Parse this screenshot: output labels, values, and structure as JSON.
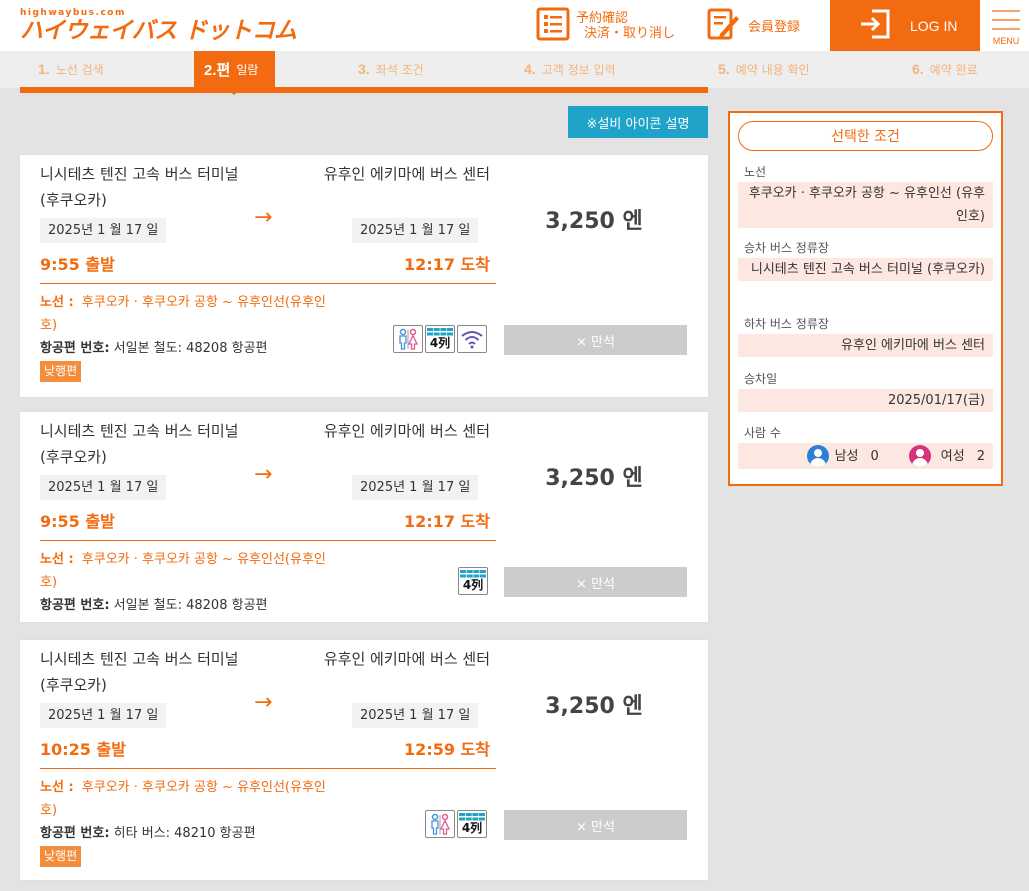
{
  "header": {
    "logo_sub": "highwaybus.com",
    "logo_main": "ハイウェイバス ドットコム",
    "reserve_line1": "予約確認",
    "reserve_line2": "決済・取り消し",
    "member_label": "会員登録",
    "login_label": "LOG IN",
    "menu_label": "MENU",
    "accent_color": "#f26b10"
  },
  "steps": [
    {
      "num": "1.",
      "label": "노선 검색"
    },
    {
      "num": "2.편",
      "label": "일람"
    },
    {
      "num": "3.",
      "label": "좌석 조건"
    },
    {
      "num": "4.",
      "label": "고객 정보 입력"
    },
    {
      "num": "5.",
      "label": "예약 내용 확인"
    },
    {
      "num": "6.",
      "label": "예약 완료"
    }
  ],
  "equipment_button": "※설비 아이콘 설명",
  "results": [
    {
      "dep_name": "니시테츠 텐진 고속 버스 터미널 (후쿠오카)",
      "arr_name": "유후인 에키마에 버스 센터",
      "dep_date": "2025년 1 월 17 일",
      "arr_date": "2025년 1 월 17 일",
      "dep_time": "9:55 출발",
      "arr_time": "12:17 도착",
      "price": "3,250 엔",
      "route_label": "노선 :",
      "route": "후쿠오카 · 후쿠오카 공항 ~ 유후인선(유후인호)",
      "flight_label": "항공편 번호:",
      "flight": "서일본 철도: 48208 항공편",
      "badge": "낮행편",
      "seat_icon_label": "4列",
      "icons": [
        "restroom-icon",
        "four-row-seat-icon",
        "wifi-icon"
      ],
      "status": "× 만석"
    },
    {
      "dep_name": "니시테츠 텐진 고속 버스 터미널 (후쿠오카)",
      "arr_name": "유후인 에키마에 버스 센터",
      "dep_date": "2025년 1 월 17 일",
      "arr_date": "2025년 1 월 17 일",
      "dep_time": "9:55 출발",
      "arr_time": "12:17 도착",
      "price": "3,250 엔",
      "route_label": "노선 :",
      "route": "후쿠오카 · 후쿠오카 공항 ~ 유후인선(유후인호)",
      "flight_label": "항공편 번호:",
      "flight": "서일본 철도: 48208 항공편",
      "seat_icon_label": "4列",
      "icons": [
        "four-row-seat-icon"
      ],
      "status": "× 만석"
    },
    {
      "dep_name": "니시테츠 텐진 고속 버스 터미널 (후쿠오카)",
      "arr_name": "유후인 에키마에 버스 센터",
      "dep_date": "2025년 1 월 17 일",
      "arr_date": "2025년 1 월 17 일",
      "dep_time": "10:25 출발",
      "arr_time": "12:59 도착",
      "price": "3,250 엔",
      "route_label": "노선 :",
      "route": "후쿠오카 · 후쿠오카 공항 ~ 유후인선(유후인호)",
      "flight_label": "항공편 번호:",
      "flight": "히타 버스: 48210 항공편",
      "badge": "낮행편",
      "seat_icon_label": "4列",
      "icons": [
        "restroom-icon",
        "four-row-seat-icon"
      ],
      "status": "× 만석"
    }
  ],
  "conditions": {
    "title": "선택한 조건",
    "route_label": "노선",
    "route_value": "후쿠오카 · 후쿠오카 공항 ~ 유후인선 (유후인호)",
    "board_label": "승차 버스 정류장",
    "board_value": "니시테츠 텐진 고속 버스 터미널 (후쿠오카)",
    "alight_label": "하차 버스 정류장",
    "alight_value": "유후인 에키마에 버스 센터",
    "date_label": "승차일",
    "date_value": "2025/01/17(금)",
    "people_label": "사람 수",
    "male_label": "남성",
    "male_count": "0",
    "female_label": "여성",
    "female_count": "2"
  }
}
